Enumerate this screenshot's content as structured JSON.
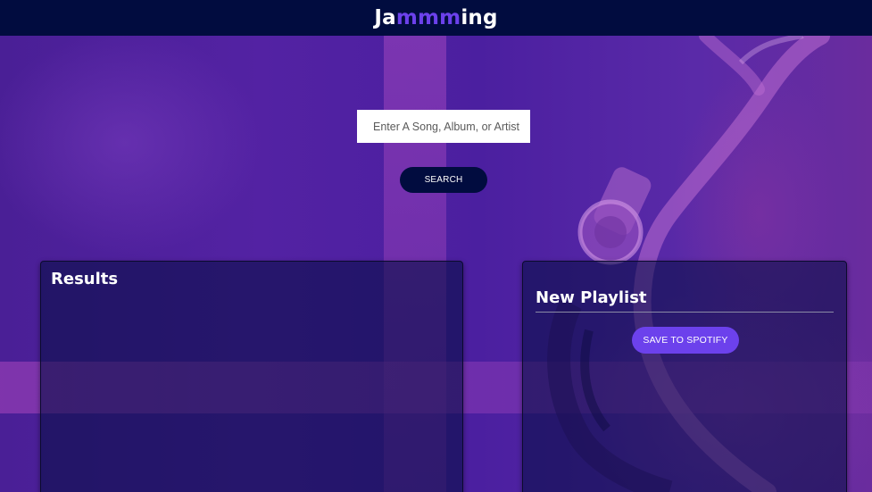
{
  "header": {
    "logo_prefix": "Ja",
    "logo_accent": "mmm",
    "logo_suffix": "ing"
  },
  "search": {
    "placeholder": "Enter A Song, Album, or Artist",
    "button_label": "SEARCH"
  },
  "results": {
    "title": "Results",
    "tracks": []
  },
  "playlist": {
    "name": "New Playlist",
    "save_label": "SAVE TO SPOTIFY",
    "tracks": []
  },
  "colors": {
    "header_bg": "#010c3f",
    "accent": "#6c41ec",
    "background": "#4a2099",
    "panel_bg": "rgba(1, 12, 63, 0.55)"
  },
  "icons": {
    "background_art": "headphones-icon"
  }
}
